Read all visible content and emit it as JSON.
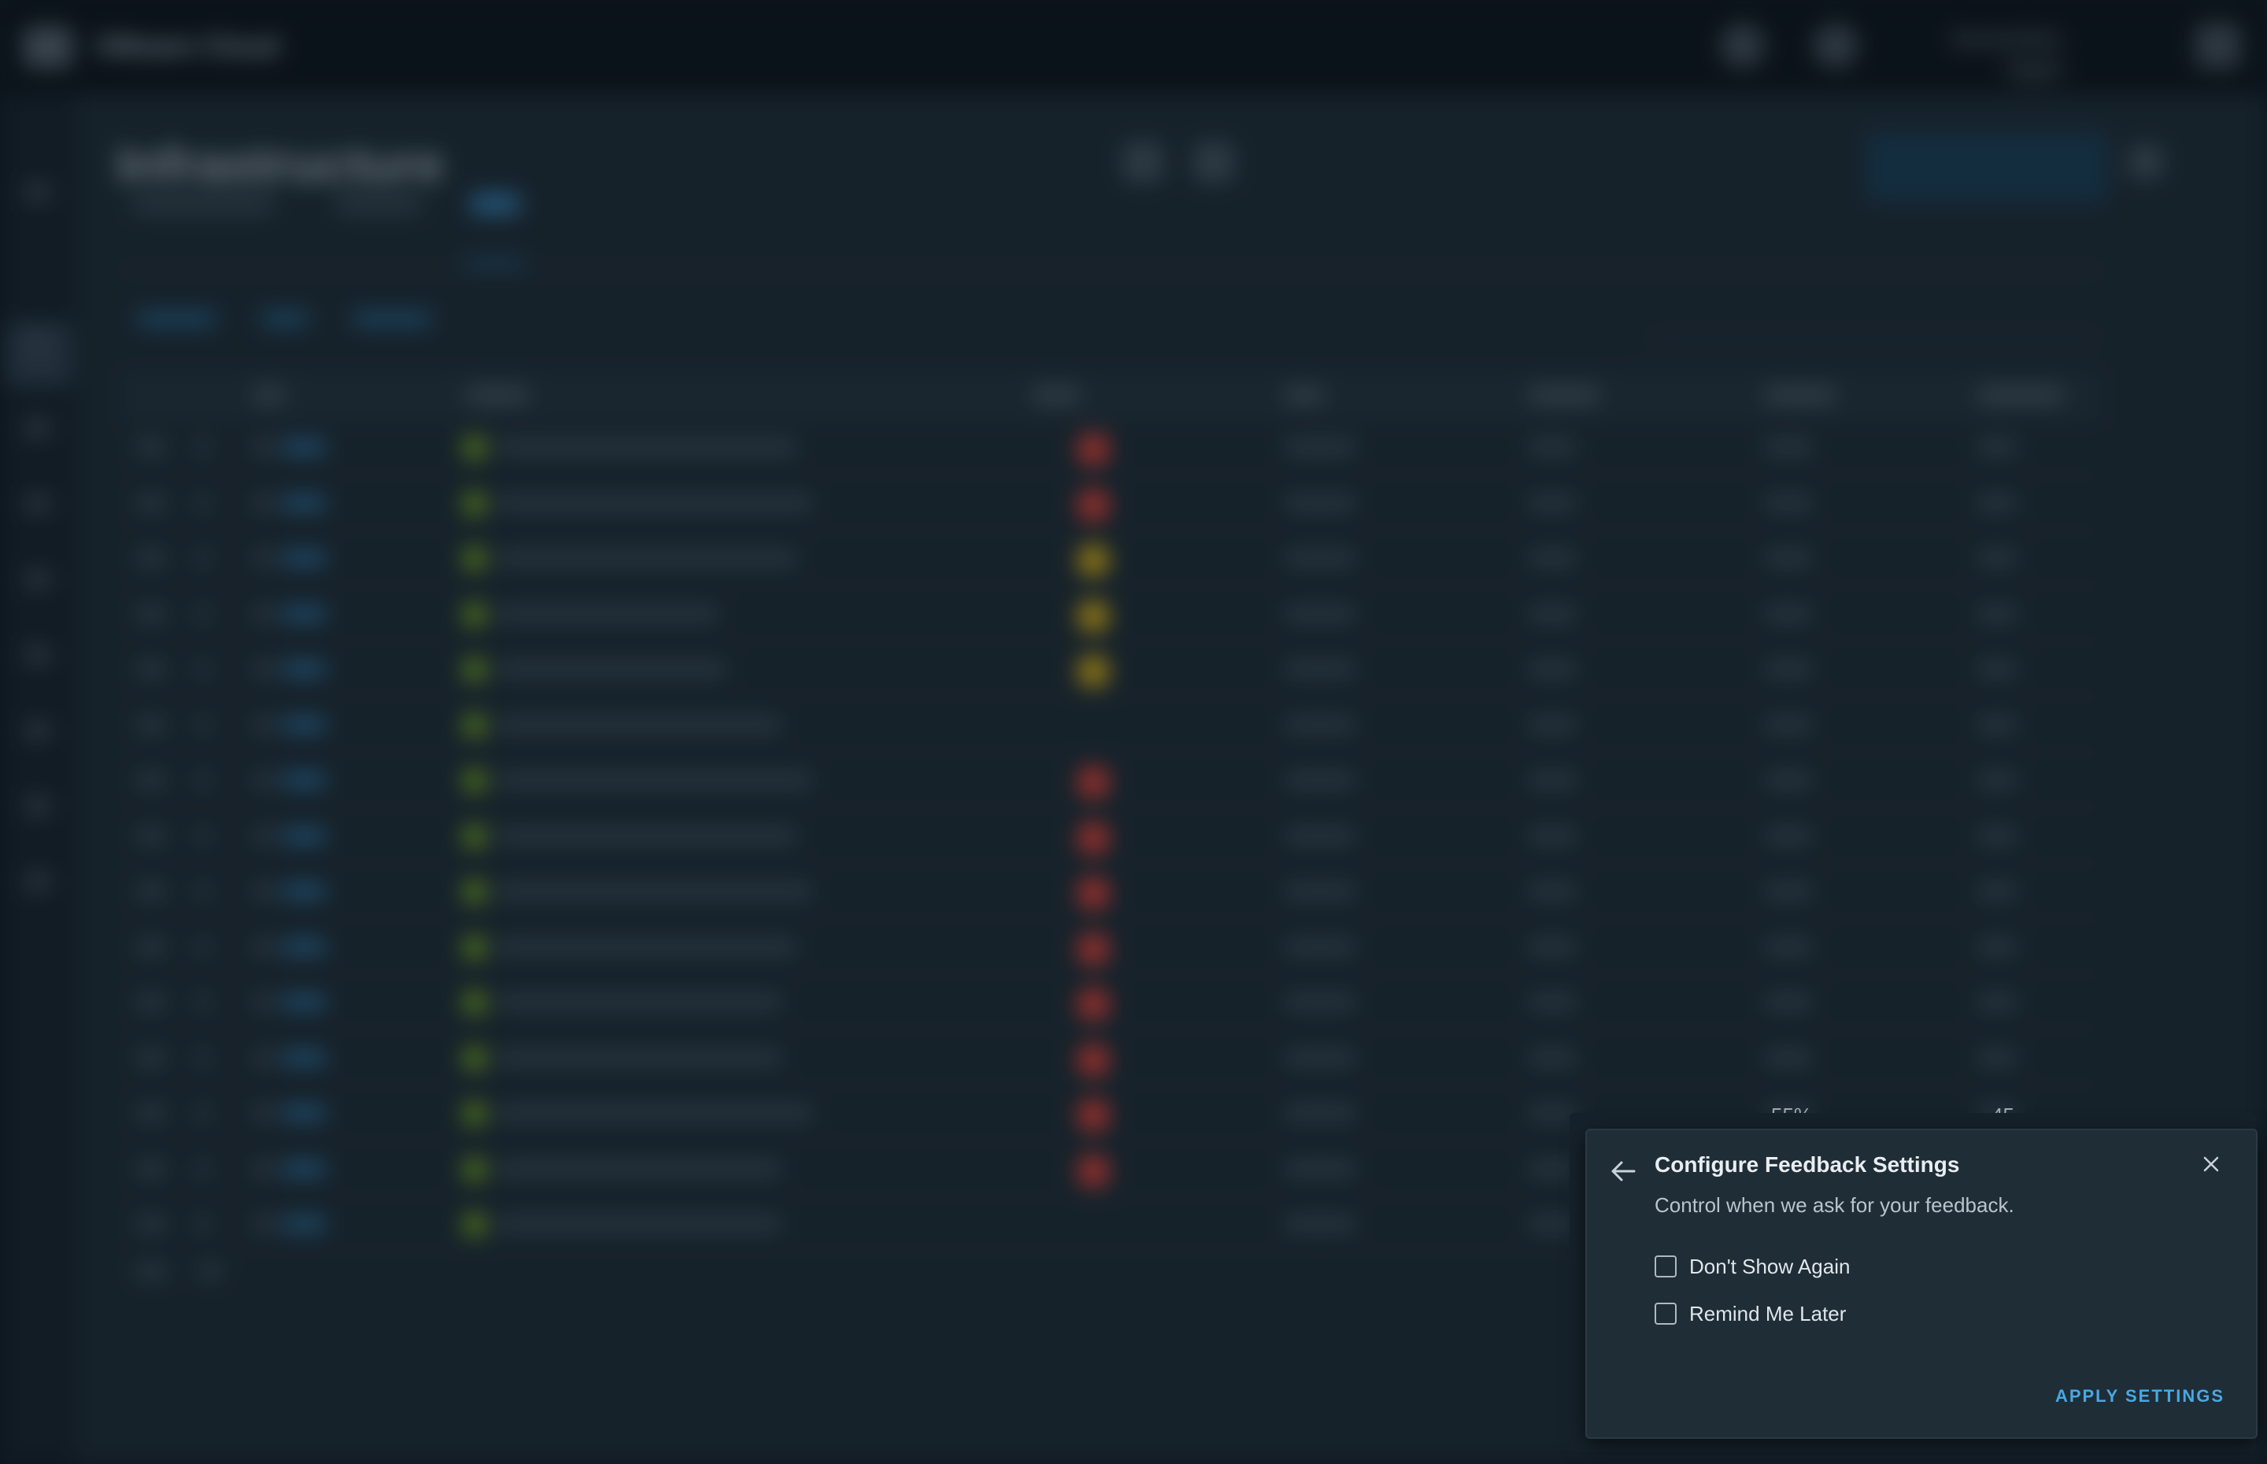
{
  "app": {
    "brand": "VMware Cloud",
    "user_name": "Stonehollow Digital",
    "user_org": "admin"
  },
  "page": {
    "title": "Infrastructure"
  },
  "peek_values": {
    "col_percent": "55%",
    "col_count": "45"
  },
  "dialog": {
    "title": "Configure Feedback Settings",
    "subtitle": "Control when we ask for your feedback.",
    "options": [
      {
        "label": "Don't Show Again",
        "checked": false
      },
      {
        "label": "Remind Me Later",
        "checked": false
      }
    ],
    "apply_label": "APPLY SETTINGS"
  },
  "colors": {
    "accent": "#47a8e4",
    "status_ok": "#6c9b1f",
    "status_critical": "#c23a34",
    "status_warning": "#b89618"
  },
  "table_row_status": [
    "critical",
    "critical",
    "warning",
    "warning",
    "warning",
    "none",
    "critical",
    "critical",
    "critical",
    "critical",
    "critical",
    "critical",
    "critical",
    "critical",
    "none"
  ]
}
